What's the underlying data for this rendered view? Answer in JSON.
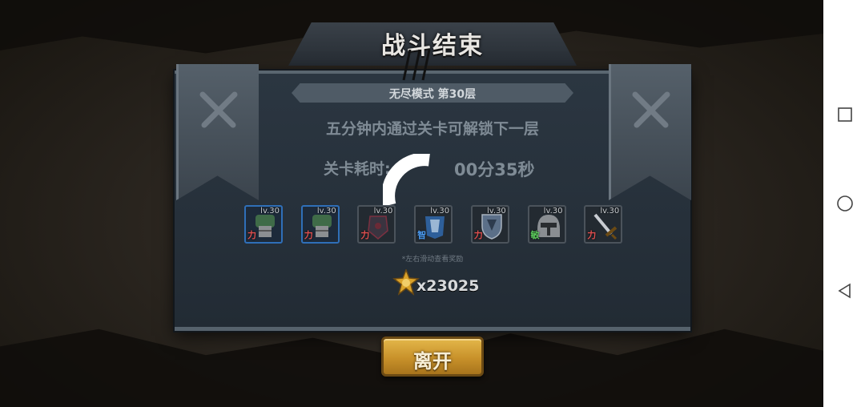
{
  "dialog": {
    "title": "战斗结束",
    "mode": "无尽模式 第30层",
    "unlock_hint": "五分钟内通过关卡可解锁下一层",
    "time_label": "关卡耗时:",
    "time_value": "00分35秒",
    "scroll_hint": "*左右滑动查看奖励",
    "gold_count": "x23025",
    "leave_label": "离开"
  },
  "rewards": [
    {
      "level": "lv.30",
      "attr": "力",
      "attr_color": "#e05050",
      "rarity": "blue",
      "icon": "green-gauntlet-icon"
    },
    {
      "level": "lv.30",
      "attr": "力",
      "attr_color": "#e05050",
      "rarity": "blue",
      "icon": "green-gauntlet-icon"
    },
    {
      "level": "lv.30",
      "attr": "力",
      "attr_color": "#e05050",
      "rarity": "gray",
      "icon": "dark-gauntlet-icon"
    },
    {
      "level": "lv.30",
      "attr": "智",
      "attr_color": "#4a9af0",
      "rarity": "gray",
      "icon": "blue-armor-icon"
    },
    {
      "level": "lv.30",
      "attr": "力",
      "attr_color": "#e05050",
      "rarity": "gray",
      "icon": "shield-icon"
    },
    {
      "level": "lv.30",
      "attr": "敏",
      "attr_color": "#5ac85a",
      "rarity": "gray",
      "icon": "helmet-icon"
    },
    {
      "level": "lv.30",
      "attr": "力",
      "attr_color": "#e05050",
      "rarity": "gray",
      "icon": "sword-icon"
    }
  ],
  "navbar": {
    "icons": [
      "recent-apps-icon",
      "home-icon",
      "back-icon"
    ]
  },
  "colors": {
    "panel": "#26303a",
    "button_gold": "#c8912a",
    "gold_star": "#d9a22a"
  }
}
